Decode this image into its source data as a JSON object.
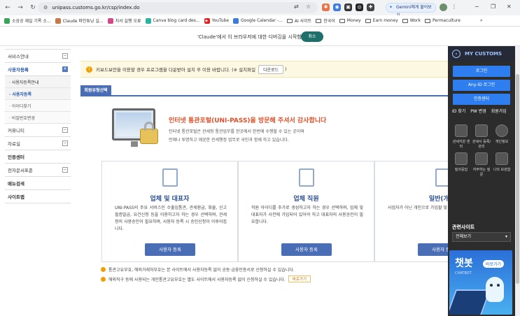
{
  "browser": {
    "url": "unipass.customs.go.kr/csp/index.do",
    "gemini_label": "Gemini에게 물어보기",
    "bookmarks": [
      "소상공 재일 기록 소...",
      "Claude 파인튜닝 실...",
      "처서 실행 오류",
      "Canva blog card des...",
      "YouTube",
      "Google Calendar -...",
      "AI 사이트",
      "한국어",
      "Money",
      "Earn money",
      "Work",
      "Permaculture"
    ],
    "bookmarks_more": "»"
  },
  "debug_bar": {
    "text": "'Claude'에서 이 브라우저에 대한 디버깅을 시작함",
    "cancel": "취소"
  },
  "left_menu": {
    "items": [
      {
        "label": "서비스안내",
        "toggle": "−"
      },
      {
        "label": "사용자등록",
        "toggle": "+"
      },
      {
        "label": "· 사용자등록안내"
      },
      {
        "label": "· 사용자등록"
      },
      {
        "label": "· 아이디찾기"
      },
      {
        "label": "· 비밀번호변경"
      },
      {
        "label": "커뮤니티",
        "toggle": "−"
      },
      {
        "label": "자료실",
        "toggle": "−"
      },
      {
        "label": "인증센터"
      },
      {
        "label": "전자문서표준",
        "toggle": "−"
      },
      {
        "label": "메뉴검색"
      },
      {
        "label": "사이트맵"
      }
    ]
  },
  "notice": {
    "text": "키보드보안을 이용할 경우 프로그램을 다운받아 설치 후 이용 바랍니다. (※ 설치파일",
    "download": "다운로드",
    "close_paren": ")"
  },
  "tab": {
    "label": "회원유형선택"
  },
  "welcome": {
    "title": "인터넷 통관포털(UNI-PASS)을 방문해 주셔서 감사합니다",
    "line1": "인터넷 통관포털은 관세청 통관업무를 한곳에서 한번에 수행할 수 있는 곳이며",
    "line2": "언제나 투명하고 깨끗한 관세행정 업무로 국민과 함께 하고 있습니다."
  },
  "cards": [
    {
      "title": "업체 및 대표자",
      "desc": "UNI-PASS의 주요 서비스인 수출입통관, 관세환급, 화물, 신고필증발급, 요건신청 등을 이용하고자 하는 경우 선택하며, 관세청의 사용승인이 필요하며, 사용자 등록 시 승인신청이 이루어집니다.",
      "button": "사용자 등록"
    },
    {
      "title": "업체 직원",
      "desc": "직원 아이디를 추가로 생성하고자 하는 경우 선택하며, 업체 및 대표자가 사전에 가입되어 있어야 하고 대표자의 사용승인이 필요합니다.",
      "button": "사용자 등록"
    },
    {
      "title": "일반(개인)",
      "desc": "사업자가 아닌 개인으로 가입할 및 공개정보에 대한 조회서비스",
      "button": "사용자 등록"
    }
  ],
  "footer_notes": [
    {
      "text": "통관고유부호, 해외거래처부호는 본 사이트에서 사용자등록 없이 공동·금융인증서로 신청하실 수 있습니다."
    },
    {
      "text": "해외직구 등에 사용되는 개인통관고유부호는 별도 사이트에서 사용자등록 없이 신청하실 수 있습니다.",
      "go": "바로가기"
    }
  ],
  "right_panel": {
    "header": "MY CUSTOMS",
    "login": "로그인",
    "anyid": "Any-ID 로그인",
    "cert": "인증센터",
    "links": [
      "ID 찾기",
      "PW 변경",
      "회원가입"
    ],
    "quick": [
      {
        "label": "관세지원 센터",
        "icon": "building-icon"
      },
      {
        "label": "관세사 등록/관리",
        "icon": "document-icon"
      },
      {
        "label": "개인정보",
        "icon": "check-icon"
      },
      {
        "label": "질의응답",
        "icon": "people-icon"
      },
      {
        "label": "자주하는 질문",
        "icon": "question-icon"
      },
      {
        "label": "나의 보관함",
        "icon": "box-icon"
      }
    ],
    "related_title": "관련사이트",
    "related_select": "전체보기",
    "chatbot": {
      "title": "챗봇",
      "go": "바로가기",
      "sub": "CHATBOT"
    }
  }
}
